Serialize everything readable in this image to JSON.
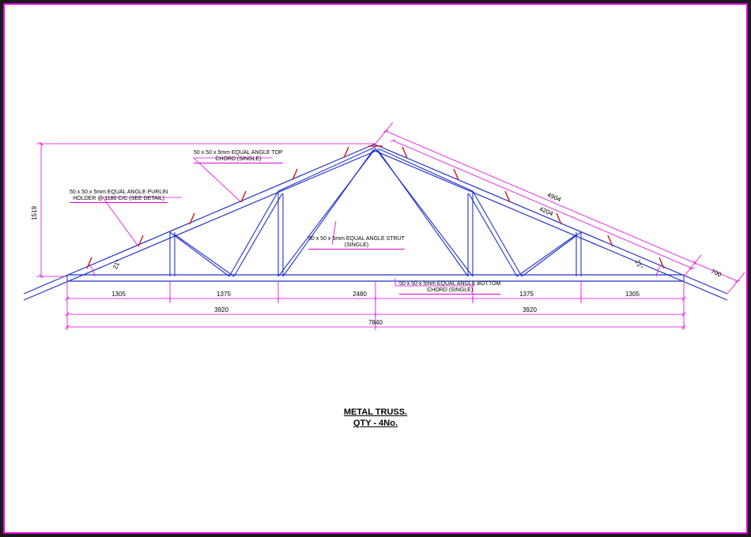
{
  "title": {
    "line1": "METAL TRUSS.",
    "line2": "QTY - 4No."
  },
  "annotations": {
    "top_chord": "50 x 50 x 5mm EQUAL ANGLE TOP CHORD (SINGLE)",
    "purlin_holder": "50 x 50 x 5mm EQUAL ANGLE PURLIN HOLDER @ 1180 C/C (SEE DETAIL)",
    "strut": "50 x 50 x 5mm EQUAL ANGLE STRUT (SINGLE)",
    "bottom_chord": "50 x 50 x 5mm EQUAL ANGLE BOTTOM CHORD (SINGLE)"
  },
  "dimensions": {
    "height": "1519",
    "seg1": "1305",
    "seg2": "1375",
    "seg3": "2480",
    "seg4": "1375",
    "seg5": "1305",
    "half_left": "3920",
    "half_right": "3920",
    "total": "7840",
    "slope_upper": "4904",
    "slope_seg": "4204",
    "slope_ext": "700",
    "angle_left": "21°",
    "angle_right": "21°"
  }
}
